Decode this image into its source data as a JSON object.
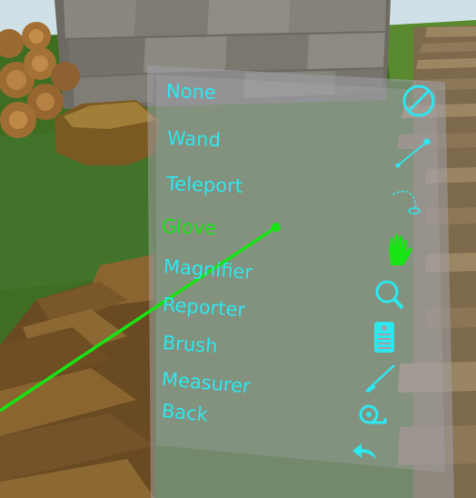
{
  "menu": {
    "items": [
      {
        "id": "none",
        "label": "None",
        "icon": "no-tool-icon",
        "selected": false
      },
      {
        "id": "wand",
        "label": "Wand",
        "icon": "wand-icon",
        "selected": false
      },
      {
        "id": "teleport",
        "label": "Teleport",
        "icon": "teleport-arc-icon",
        "selected": false
      },
      {
        "id": "glove",
        "label": "Glove",
        "icon": "glove-icon",
        "selected": true
      },
      {
        "id": "magnifier",
        "label": "Magnifier",
        "icon": "magnifier-icon",
        "selected": false
      },
      {
        "id": "reporter",
        "label": "Reporter",
        "icon": "reporter-icon",
        "selected": false
      },
      {
        "id": "brush",
        "label": "Brush",
        "icon": "brush-icon",
        "selected": false
      },
      {
        "id": "measurer",
        "label": "Measurer",
        "icon": "tape-measure-icon",
        "selected": false
      },
      {
        "id": "back",
        "label": "Back",
        "icon": "back-arrow-icon",
        "selected": false
      }
    ]
  },
  "colors": {
    "menu_text": "#2ee6ee",
    "selected_text": "#18e414",
    "pointer_ray": "#18e414",
    "panel": "#a0a0a8"
  }
}
